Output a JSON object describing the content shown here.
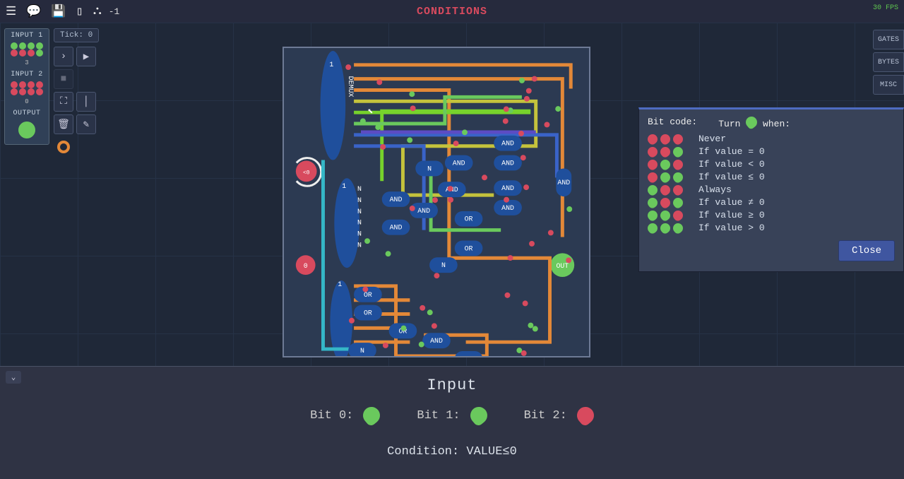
{
  "top": {
    "title": "CONDITIONS",
    "score": "-1",
    "fps": "30 FPS"
  },
  "io": {
    "input1_label": "INPUT 1",
    "input1_bits": [
      true,
      true,
      true,
      true,
      false,
      false,
      false,
      true
    ],
    "input1_num": "3",
    "input2_label": "INPUT 2",
    "input2_bits": [
      false,
      false,
      false,
      false,
      false,
      false,
      false,
      false
    ],
    "input2_num": "0",
    "output_label": "OUTPUT",
    "output_on": true
  },
  "sim": {
    "tick": "Tick: 0"
  },
  "categories": {
    "gates": "GATES",
    "bytes": "BYTES",
    "misc": "MISC"
  },
  "circuit": {
    "demux_label": "DEMUX",
    "out_label": "OUT",
    "zero_label": "0",
    "one_label": "1",
    "knob_label": "<0",
    "gates": [
      "AND",
      "AND",
      "AND",
      "AND",
      "AND",
      "AND",
      "AND",
      "AND",
      "AND",
      "AND",
      "AND",
      "OR",
      "OR",
      "OR",
      "OR",
      "OR",
      "N",
      "N",
      "N",
      "N",
      "N",
      "N",
      "N",
      "N"
    ]
  },
  "popup": {
    "hdr_bitcode": "Bit code:",
    "hdr_turn_prefix": "Turn ",
    "hdr_turn_suffix": " when:",
    "rows": [
      {
        "bits": [
          false,
          false,
          false
        ],
        "cond": "Never"
      },
      {
        "bits": [
          false,
          false,
          true
        ],
        "cond": "If value = 0"
      },
      {
        "bits": [
          false,
          true,
          false
        ],
        "cond": "If value < 0"
      },
      {
        "bits": [
          false,
          true,
          true
        ],
        "cond": "If value ≤ 0"
      },
      {
        "bits": [
          true,
          false,
          false
        ],
        "cond": "Always"
      },
      {
        "bits": [
          true,
          false,
          true
        ],
        "cond": "If value ≠ 0"
      },
      {
        "bits": [
          true,
          true,
          false
        ],
        "cond": "If value ≥ 0"
      },
      {
        "bits": [
          true,
          true,
          true
        ],
        "cond": "If value > 0"
      }
    ],
    "close": "Close"
  },
  "input_panel": {
    "heading": "Input",
    "bits": [
      {
        "label": "Bit 0:",
        "on": true
      },
      {
        "label": "Bit 1:",
        "on": true
      },
      {
        "label": "Bit 2:",
        "on": false
      }
    ],
    "condition_prefix": "Condition: ",
    "condition_value": "VALUE≤0"
  }
}
